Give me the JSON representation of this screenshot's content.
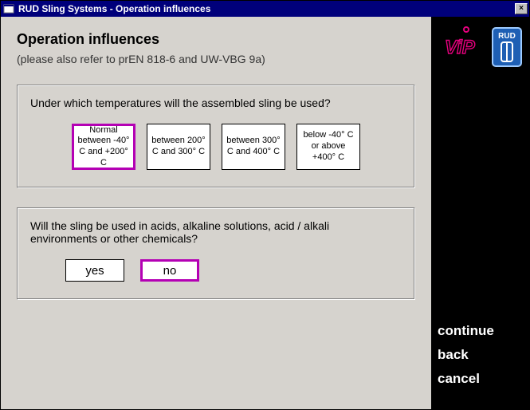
{
  "titlebar": {
    "title": "RUD Sling Systems - Operation influences",
    "close_icon": "×"
  },
  "page": {
    "heading": "Operation influences",
    "subtitle": "(please also refer to prEN 818-6 and UW-VBG 9a)"
  },
  "q_temp": {
    "question": "Under which temperatures will the assembled sling be used?",
    "options": [
      {
        "label": "Normal between -40° C and +200° C",
        "selected": true
      },
      {
        "label": "between 200° C and 300° C",
        "selected": false
      },
      {
        "label": "between 300° C and 400° C",
        "selected": false
      },
      {
        "label": "below -40° C or above +400° C",
        "selected": false
      }
    ]
  },
  "q_chem": {
    "question": "Will the sling be used in acids, alkaline solutions, acid / alkali environments or other chemicals?",
    "yes": {
      "label": "yes",
      "selected": false
    },
    "no": {
      "label": "no",
      "selected": true
    }
  },
  "sidebar": {
    "continue": "continue",
    "back": "back",
    "cancel": "cancel"
  }
}
